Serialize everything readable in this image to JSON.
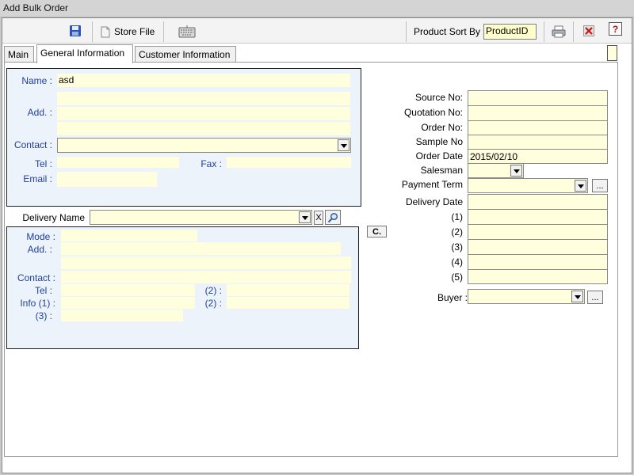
{
  "window": {
    "title": "Add Bulk Order"
  },
  "toolbar": {
    "save_icon": "floppy-disk-icon",
    "store_file_label": "Store File",
    "keyboard_icon": "keyboard-icon",
    "product_sort_label": "Product Sort By",
    "product_sort_value": "ProductID",
    "print_icon": "printer-icon",
    "close_icon": "close-icon",
    "help_icon": "help-icon",
    "help_glyph": "?"
  },
  "tabs": [
    "Main",
    "General Information",
    "Customer Information"
  ],
  "customer": {
    "name_label": "Name :",
    "name_value": "asd",
    "address_label": "Add. :",
    "contact_label": "Contact :",
    "tel_label": "Tel :",
    "fax_label": "Fax :",
    "email_label": "Email :"
  },
  "delivery": {
    "name_label": "Delivery Name",
    "clear_button": "X",
    "search_icon": "search-icon",
    "mode_label": "Mode :",
    "address_label": "Add. :",
    "contact_label": "Contact :",
    "tel_label": "Tel :",
    "tel2_label": "(2) :",
    "info1_label": "Info (1) :",
    "info2_label": "(2) :",
    "info3_label": "(3) :"
  },
  "copy_button": "C.",
  "order": {
    "source_no_label": "Source No:",
    "quotation_no_label": "Quotation No:",
    "order_no_label": "Order No:",
    "sample_no_label": "Sample No",
    "order_date_label": "Order Date",
    "order_date_value": "2015/02/10",
    "salesman_label": "Salesman",
    "payment_term_label": "Payment Term",
    "more_button": "...",
    "delivery_date_label": "Delivery Date",
    "date_1_label": "(1)",
    "date_2_label": "(2)",
    "date_3_label": "(3)",
    "date_4_label": "(4)",
    "date_5_label": "(5)",
    "buyer_label": "Buyer :",
    "buyer_more_button": "..."
  },
  "colors": {
    "field_bg": "#ffffdd",
    "panel_bg": "#edf3fb",
    "label_blue": "#1f3f9f"
  }
}
